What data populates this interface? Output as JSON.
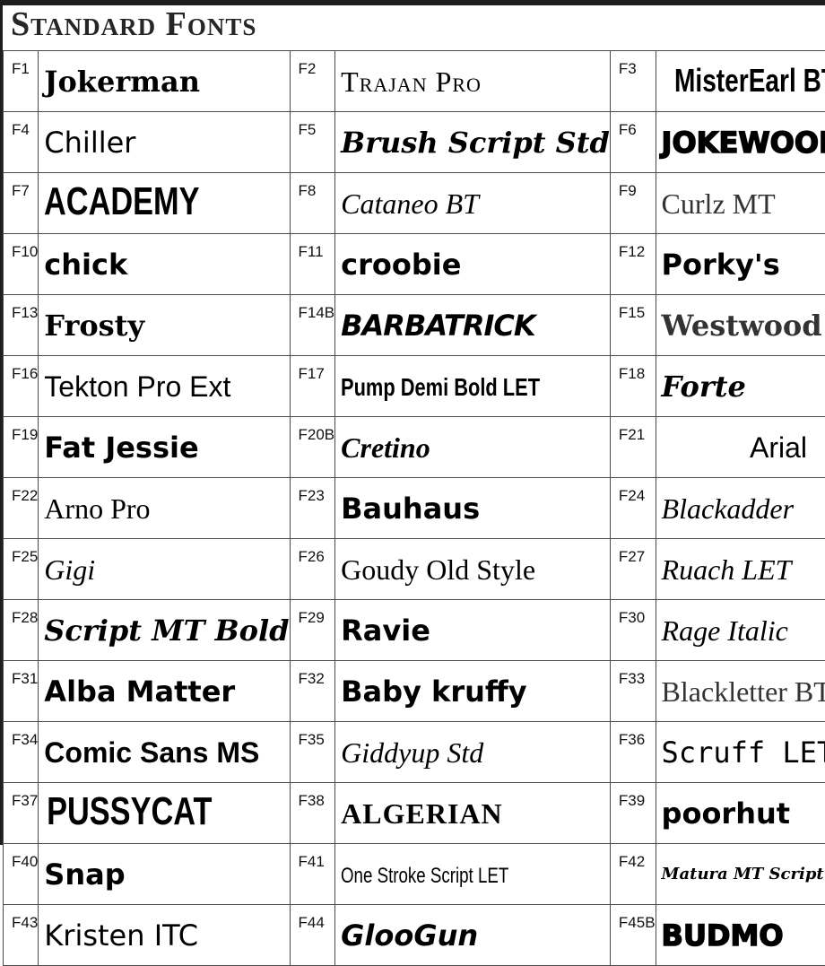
{
  "title": "Standard Fonts",
  "rows": [
    [
      {
        "code": "F1",
        "name": "Jokerman"
      },
      {
        "code": "F2",
        "name": "Trajan Pro"
      },
      {
        "code": "F3",
        "name": "MisterEarl BT"
      }
    ],
    [
      {
        "code": "F4",
        "name": "Chiller"
      },
      {
        "code": "F5",
        "name": "Brush Script Std"
      },
      {
        "code": "F6",
        "name": "JOKEWOOD"
      }
    ],
    [
      {
        "code": "F7",
        "name": "ACADEMY"
      },
      {
        "code": "F8",
        "name": "Cataneo BT"
      },
      {
        "code": "F9",
        "name": "Curlz MT"
      }
    ],
    [
      {
        "code": "F10",
        "name": "chick"
      },
      {
        "code": "F11",
        "name": "croobie"
      },
      {
        "code": "F12",
        "name": "Porky's"
      }
    ],
    [
      {
        "code": "F13",
        "name": "Frosty"
      },
      {
        "code": "F14B",
        "name": "BARBATRICK"
      },
      {
        "code": "F15",
        "name": "Westwood LET"
      }
    ],
    [
      {
        "code": "F16",
        "name": "Tekton Pro Ext"
      },
      {
        "code": "F17",
        "name": "Pump Demi Bold LET"
      },
      {
        "code": "F18",
        "name": "Forte"
      }
    ],
    [
      {
        "code": "F19",
        "name": "Fat Jessie"
      },
      {
        "code": "F20B",
        "name": "Cretino"
      },
      {
        "code": "F21",
        "name": "Arial"
      }
    ],
    [
      {
        "code": "F22",
        "name": "Arno Pro"
      },
      {
        "code": "F23",
        "name": "Bauhaus"
      },
      {
        "code": "F24",
        "name": "Blackadder"
      }
    ],
    [
      {
        "code": "F25",
        "name": "Gigi"
      },
      {
        "code": "F26",
        "name": "Goudy Old Style"
      },
      {
        "code": "F27",
        "name": "Ruach LET"
      }
    ],
    [
      {
        "code": "F28",
        "name": "Script MT Bold"
      },
      {
        "code": "F29",
        "name": "Ravie"
      },
      {
        "code": "F30",
        "name": "Rage Italic"
      }
    ],
    [
      {
        "code": "F31",
        "name": "Alba Matter"
      },
      {
        "code": "F32",
        "name": "Baby kruffy"
      },
      {
        "code": "F33",
        "name": "Blackletter BT"
      }
    ],
    [
      {
        "code": "F34",
        "name": "Comic Sans MS"
      },
      {
        "code": "F35",
        "name": "Giddyup Std"
      },
      {
        "code": "F36",
        "name": "Scruff LET"
      }
    ],
    [
      {
        "code": "F37",
        "name": "PUSSYCAT"
      },
      {
        "code": "F38",
        "name": "ALGERIAN"
      },
      {
        "code": "F39",
        "name": "poorhut"
      }
    ],
    [
      {
        "code": "F40",
        "name": "Snap"
      },
      {
        "code": "F41",
        "name": "One Stroke Script LET"
      },
      {
        "code": "F42",
        "name": "Matura MT Script"
      }
    ],
    [
      {
        "code": "F43",
        "name": "Kristen ITC"
      },
      {
        "code": "F44",
        "name": "GlooGun"
      },
      {
        "code": "F45B",
        "name": "BUDMO"
      }
    ]
  ]
}
